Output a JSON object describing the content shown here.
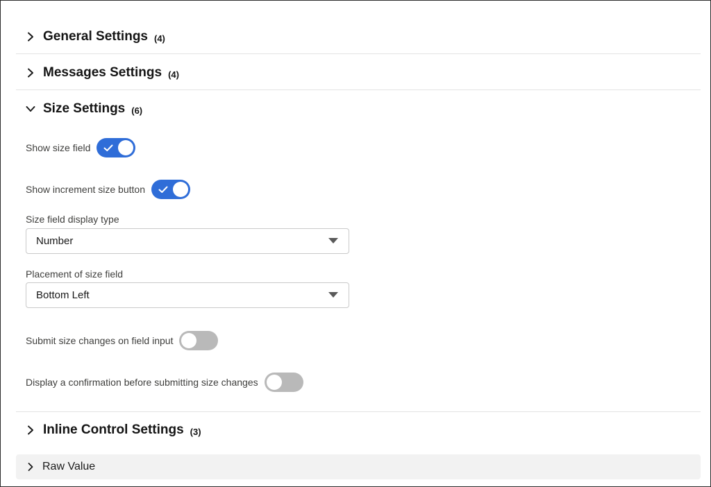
{
  "sections": {
    "general": {
      "title": "General Settings",
      "count": "(4)",
      "expanded": false
    },
    "messages": {
      "title": "Messages Settings",
      "count": "(4)",
      "expanded": false
    },
    "size": {
      "title": "Size Settings",
      "count": "(6)",
      "expanded": true
    },
    "inline": {
      "title": "Inline Control Settings",
      "count": "(3)",
      "expanded": false
    }
  },
  "size_settings": {
    "show_size_field": {
      "label": "Show size field",
      "value": true
    },
    "show_increment_button": {
      "label": "Show increment size button",
      "value": true
    },
    "display_type": {
      "label": "Size field display type",
      "value": "Number"
    },
    "placement": {
      "label": "Placement of size field",
      "value": "Bottom Left"
    },
    "submit_on_input": {
      "label": "Submit size changes on field input",
      "value": false
    },
    "confirm_before_submit": {
      "label": "Display a confirmation before submitting size changes",
      "value": false
    }
  },
  "raw_value": {
    "label": "Raw Value"
  },
  "colors": {
    "toggle_on": "#2f6dd8",
    "toggle_off": "#b9b9b9",
    "divider": "#e3e3e3",
    "raw_bar_bg": "#f2f2f2"
  },
  "icons": {
    "collapsed": "chevron-right-icon",
    "expanded": "chevron-down-icon",
    "dropdown": "caret-down-icon",
    "toggle_check": "check-icon"
  }
}
